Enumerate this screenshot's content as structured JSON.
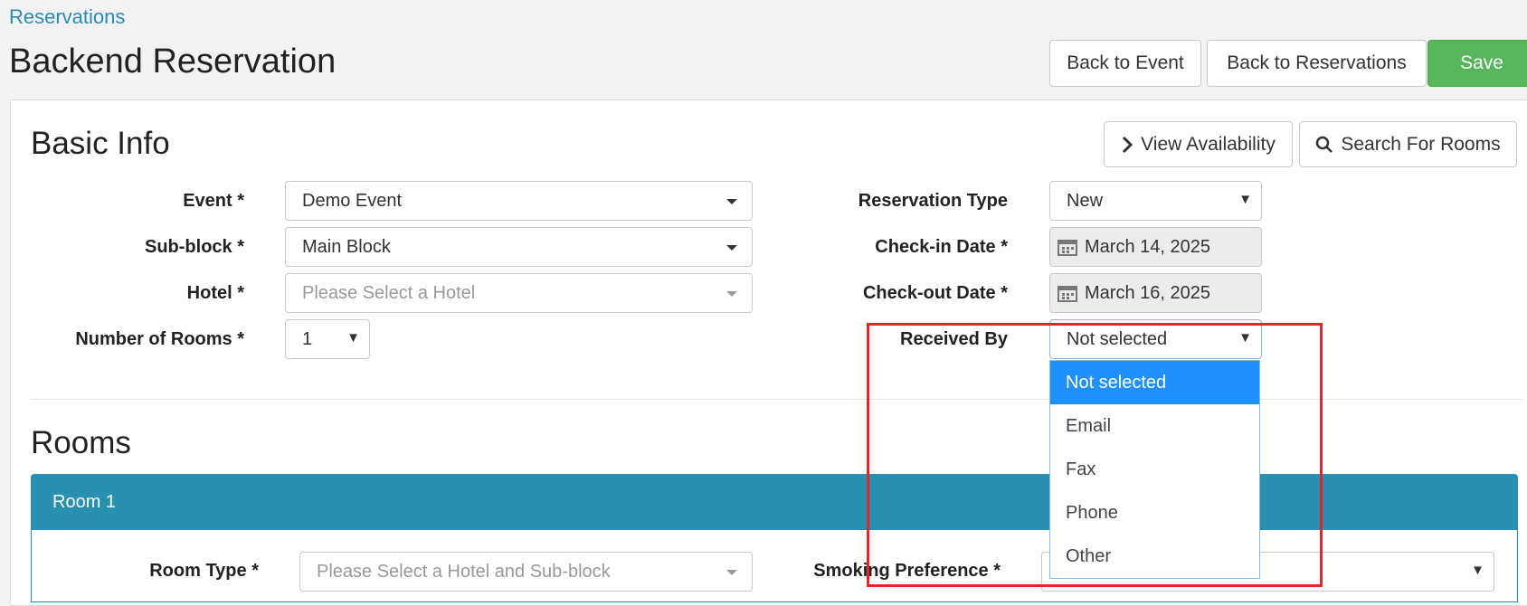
{
  "breadcrumb": "Reservations",
  "page_title": "Backend Reservation",
  "toolbar": {
    "back_event": "Back to Event",
    "back_reservations": "Back to Reservations",
    "save": "Save"
  },
  "basic_info": {
    "title": "Basic Info",
    "view_availability": "View Availability",
    "search_rooms": "Search For Rooms",
    "event": {
      "label": "Event *",
      "value": "Demo Event"
    },
    "subblock": {
      "label": "Sub-block *",
      "value": "Main Block"
    },
    "hotel": {
      "label": "Hotel *",
      "placeholder": "Please Select a Hotel"
    },
    "num_rooms": {
      "label": "Number of Rooms *",
      "value": "1"
    },
    "reservation_type": {
      "label": "Reservation Type",
      "value": "New"
    },
    "checkin": {
      "label": "Check-in Date *",
      "value": "March 14, 2025"
    },
    "checkout": {
      "label": "Check-out Date *",
      "value": "March 16, 2025"
    },
    "received_by": {
      "label": "Received By",
      "value": "Not selected",
      "options": [
        "Not selected",
        "Email",
        "Fax",
        "Phone",
        "Other"
      ]
    }
  },
  "rooms": {
    "title": "Rooms",
    "room1": {
      "header": "Room 1",
      "room_type": {
        "label": "Room Type *",
        "placeholder": "Please Select a Hotel and Sub-block"
      },
      "smoking": {
        "label": "Smoking Preference *"
      }
    }
  },
  "colors": {
    "primary_blue": "#2990b0",
    "save_green": "#57b65a",
    "highlight_red": "#e4262b",
    "selected_option": "#1e90ff"
  },
  "icons": [
    "chevron-right-icon",
    "search-icon",
    "calendar-icon",
    "caret-down-icon"
  ]
}
